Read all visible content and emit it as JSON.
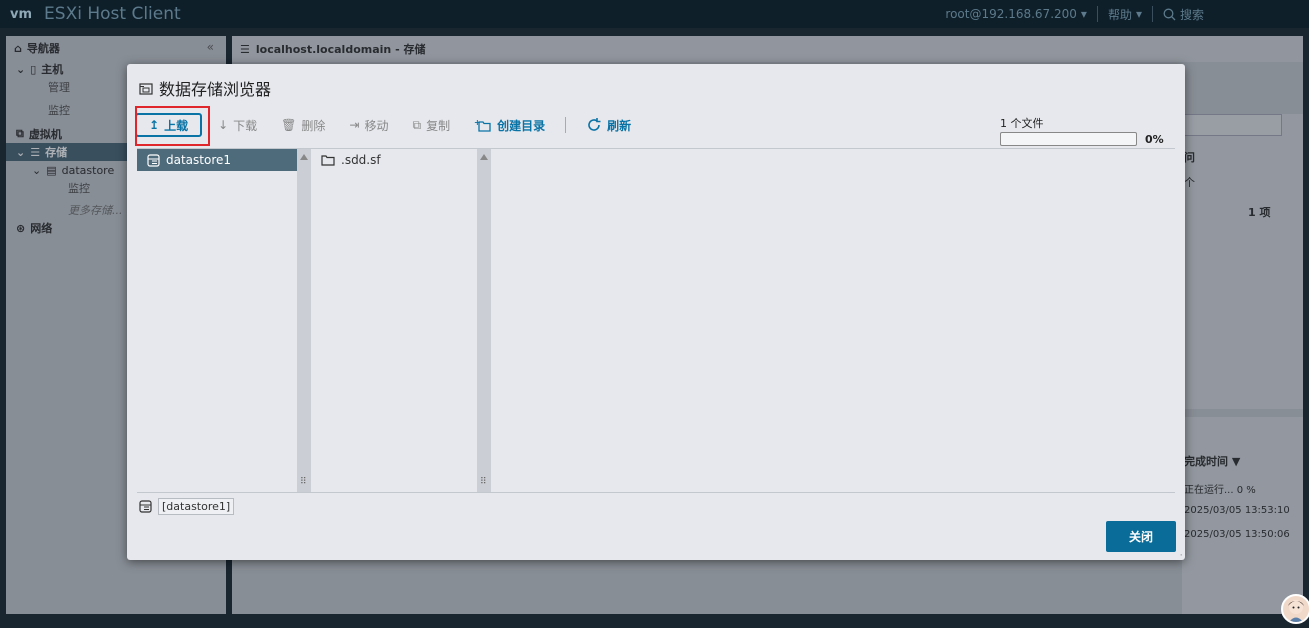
{
  "topbar": {
    "logo": "vm",
    "app_title": "ESXi Host Client",
    "user": "root@192.168.67.200",
    "help": "帮助",
    "search": "搜索"
  },
  "nav": {
    "header": "导航器",
    "host": "主机",
    "manage": "管理",
    "monitor": "监控",
    "vms": "虚拟机",
    "storage": "存储",
    "datastore": "datastore",
    "ds_monitor": "监控",
    "more_storage": "更多存储...",
    "network": "网络"
  },
  "main": {
    "title": "localhost.localdomain - 存储",
    "right_col_header": "问",
    "right_sub": "个",
    "items_count": "1 项",
    "tasks_header": "完成时间 ▼",
    "task1": "正在运行... 0 %",
    "task2": "2025/03/05 13:53:10",
    "task3": "2025/03/05 13:50:06"
  },
  "modal": {
    "title": "数据存储浏览器",
    "toolbar": {
      "upload": "上载",
      "download": "下载",
      "delete": "删除",
      "move": "移动",
      "copy": "复制",
      "mkdir": "创建目录",
      "refresh": "刷新"
    },
    "progress": {
      "label": "1 个文件",
      "percent": "0%",
      "value": 0
    },
    "datastores": [
      "datastore1"
    ],
    "folders": [
      ".sdd.sf"
    ],
    "path": "[datastore1]",
    "close": "关闭"
  },
  "colors": {
    "accent": "#0a73a6",
    "highlight_outline": "#e0252b",
    "selected_row": "#4e6b7c"
  }
}
